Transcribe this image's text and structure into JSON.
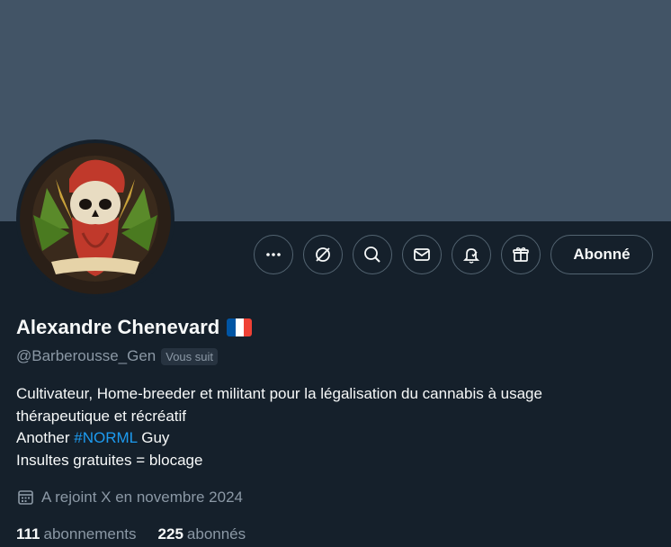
{
  "profile": {
    "display_name": "Alexandre Chenevard",
    "handle": "@Barberousse_Gen",
    "follows_you_badge": "Vous suit",
    "flag_icon": "france-flag-icon",
    "bio": {
      "line1": "Cultivateur, Home-breeder et militant pour la légalisation du cannabis à usage",
      "line2": "thérapeutique et récréatif",
      "line3_prefix": "Another",
      "line3_hashtag": "#NORML",
      "line3_suffix": "Guy",
      "line4": "Insultes gratuites = blocage"
    },
    "joined": "A rejoint X en novembre 2024",
    "following_count": "111",
    "following_label": "abonnements",
    "followers_count": "225",
    "followers_label": "abonnés"
  },
  "actions": {
    "more_icon": "more-icon",
    "grok_icon": "grok-icon",
    "search_icon": "search-icon",
    "message_icon": "message-icon",
    "notify_icon": "notification-bell-icon",
    "gift_icon": "gift-icon",
    "follow_label": "Abonné"
  },
  "colors": {
    "background": "#15202b",
    "banner": "#425466",
    "text_primary": "#f7f9f9",
    "text_secondary": "#8b98a5",
    "border": "#536471",
    "link": "#1d9bf0"
  }
}
